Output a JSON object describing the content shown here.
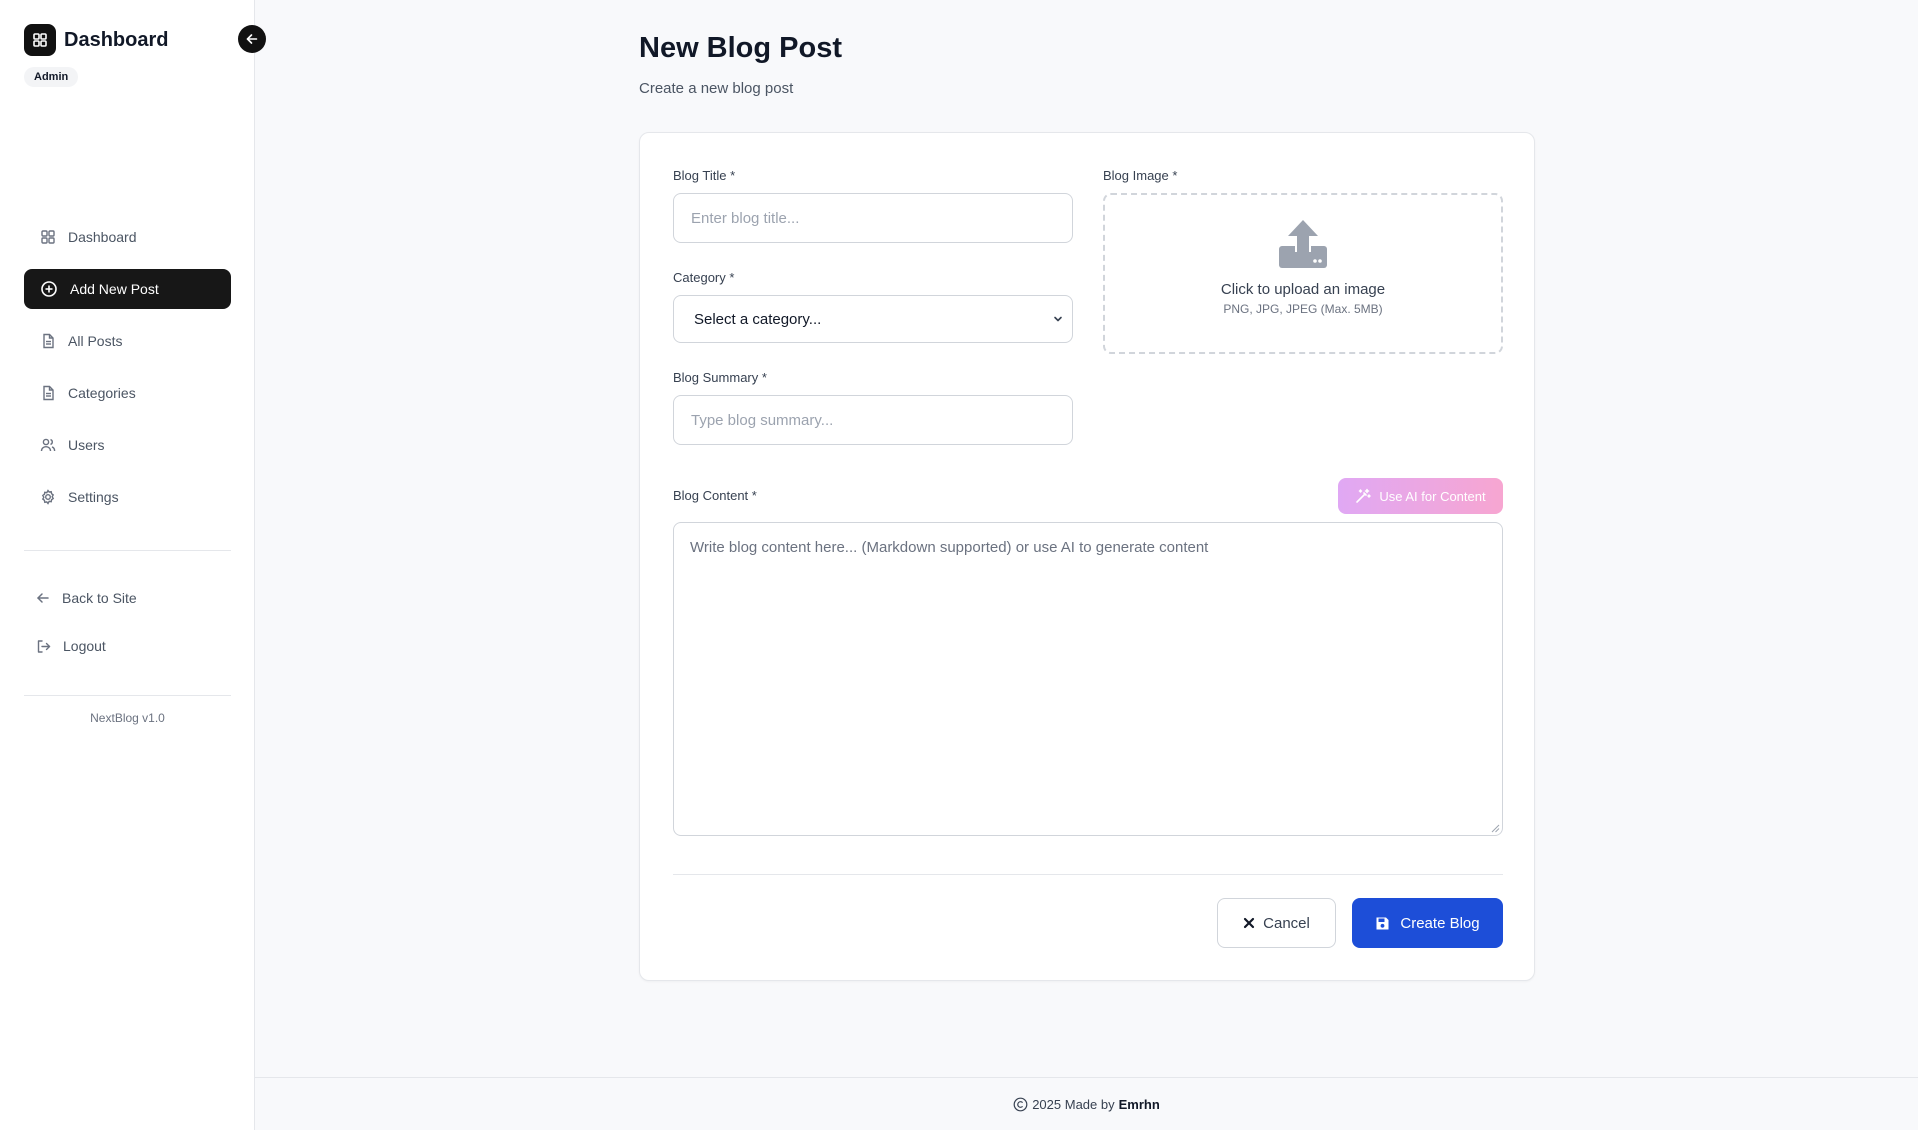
{
  "sidebar": {
    "brand_title": "Dashboard",
    "role_badge": "Admin",
    "nav": [
      {
        "label": "Dashboard",
        "icon": "grid-icon"
      },
      {
        "label": "Add New Post",
        "icon": "plus-circle-icon",
        "active": true
      },
      {
        "label": "All Posts",
        "icon": "document-icon"
      },
      {
        "label": "Categories",
        "icon": "document-icon"
      },
      {
        "label": "Users",
        "icon": "users-icon"
      },
      {
        "label": "Settings",
        "icon": "gear-icon"
      }
    ],
    "back_to_site": "Back to Site",
    "logout": "Logout",
    "version": "NextBlog v1.0"
  },
  "header": {
    "title": "New Blog Post",
    "subtitle": "Create a new blog post"
  },
  "form": {
    "title_label": "Blog Title *",
    "title_placeholder": "Enter blog title...",
    "category_label": "Category *",
    "category_selected": "Select a category...",
    "summary_label": "Blog Summary *",
    "summary_placeholder": "Type blog summary...",
    "image_label": "Blog Image *",
    "upload_text": "Click to upload an image",
    "upload_hint": "PNG, JPG, JPEG (Max. 5MB)",
    "content_label": "Blog Content *",
    "ai_button": "Use AI for Content",
    "content_placeholder": "Write blog content here... (Markdown supported) or use AI to generate content",
    "cancel_label": "Cancel",
    "create_label": "Create Blog"
  },
  "footer": {
    "text": "2025 Made by",
    "author": "Emrhn"
  },
  "colors": {
    "primary": "#1d4ed8",
    "active_nav": "#171717",
    "ai_gradient_start": "#e0a8f4",
    "ai_gradient_end": "#f7a6d1"
  }
}
